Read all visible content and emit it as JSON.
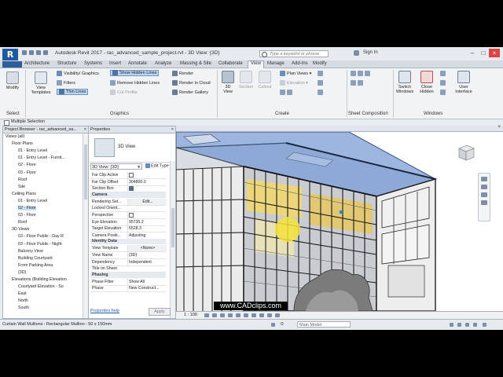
{
  "app": {
    "logo": "R",
    "title": "Autodesk Revit 2017 -    rac_advanced_sample_project.rvt - 3D View: {3D}",
    "search_placeholder": "Type a keyword or phrase",
    "sign_in": "Sign In"
  },
  "tabs": [
    "Architecture",
    "Structure",
    "Systems",
    "Insert",
    "Annotate",
    "Analyze",
    "Massing & Site",
    "Collaborate",
    "View",
    "Manage",
    "Add-Ins",
    "Modify"
  ],
  "active_tab": "View",
  "ribbon": {
    "modify": "Modify",
    "view_templates": "View Templates",
    "visibility_graphics": "Visibility/ Graphics",
    "filters": "Filters",
    "thin_lines": "Thin Lines",
    "show_hidden_lines": "Show Hidden Lines",
    "remove_hidden_lines": "Remove Hidden Lines",
    "cut_profile": "Cut Profile",
    "render": "Render",
    "render_in_cloud": "Render in Cloud",
    "render_gallery": "Render Gallery",
    "view_3d": "3D View",
    "section": "Section",
    "callout": "Callout",
    "plan_views": "Plan Views",
    "elevation": "Elevation",
    "switch_windows": "Switch Windows",
    "close_hidden": "Close Hidden",
    "user_interface": "User Interface",
    "panels": {
      "select": "Select",
      "graphics": "Graphics",
      "create": "Create",
      "sheet_composition": "Sheet Composition",
      "windows": "Windows"
    }
  },
  "multiple_selection": "Multiple Selection",
  "browser": {
    "title": "Project Browser - rac_advanced_sa...",
    "items": [
      {
        "label": "Views (all)",
        "level": 0
      },
      {
        "label": "Floor Plans",
        "level": 1
      },
      {
        "label": "01 - Entry Level",
        "level": 2
      },
      {
        "label": "01 - Entry Level - Furnit...",
        "level": 2
      },
      {
        "label": "02 - Floor",
        "level": 2
      },
      {
        "label": "03 - Floor",
        "level": 2
      },
      {
        "label": "Roof",
        "level": 2
      },
      {
        "label": "Site",
        "level": 2
      },
      {
        "label": "Ceiling Plans",
        "level": 1
      },
      {
        "label": "01 - Entry Level",
        "level": 2
      },
      {
        "label": "02 - Floor",
        "level": 2,
        "selected": true
      },
      {
        "label": "03 - Floor",
        "level": 2
      },
      {
        "label": "Roof",
        "level": 2
      },
      {
        "label": "3D Views",
        "level": 1
      },
      {
        "label": "03 - Floor Public - Day R",
        "level": 2
      },
      {
        "label": "03 - Floor Public - Night",
        "level": 2
      },
      {
        "label": "Balcony View",
        "level": 2
      },
      {
        "label": "Building Courtyard",
        "level": 2
      },
      {
        "label": "From Parking Area",
        "level": 2
      },
      {
        "label": "{3D}",
        "level": 2
      },
      {
        "label": "Elevations (Building Elevation",
        "level": 1
      },
      {
        "label": "Courtyard Elevation - So",
        "level": 2
      },
      {
        "label": "East",
        "level": 2
      },
      {
        "label": "North",
        "level": 2
      },
      {
        "label": "South",
        "level": 2
      }
    ]
  },
  "properties": {
    "title": "Properties",
    "type_name": "3D View",
    "type_selector": "3D View: {3D}",
    "edit_type": "Edit Type",
    "rows": [
      {
        "k": "Far Clip Active",
        "v": "",
        "check": false
      },
      {
        "k": "Far Clip Offset",
        "v": "304800.0"
      },
      {
        "k": "Section Box",
        "v": "",
        "check": true
      },
      {
        "head": "Camera"
      },
      {
        "k": "Rendering Set...",
        "v": "Edit...",
        "btn": true
      },
      {
        "k": "Locked Orient...",
        "v": ""
      },
      {
        "k": "Perspective",
        "v": "",
        "check": false
      },
      {
        "k": "Eye Elevation",
        "v": "95735.2"
      },
      {
        "k": "Target Elevation",
        "v": "5528.3"
      },
      {
        "k": "Camera Positi...",
        "v": "Adjusting"
      },
      {
        "head": "Identity Data"
      },
      {
        "k": "View Template",
        "v": "<None>",
        "btn": true
      },
      {
        "k": "View Name",
        "v": "{3D}"
      },
      {
        "k": "Dependency",
        "v": "Independent"
      },
      {
        "k": "Title on Sheet",
        "v": ""
      },
      {
        "head": "Phasing"
      },
      {
        "k": "Phase Filter",
        "v": "Show All"
      },
      {
        "k": "Phase",
        "v": "New Construct..."
      }
    ],
    "help": "Properties help",
    "apply": "Apply"
  },
  "viewbar": {
    "scale": "1 : 100"
  },
  "watermark": "www.CADclips.com",
  "status": {
    "text": "Curtain Wall Mullions : Rectangular Mullion : 50 x 150mm",
    "model": "Main Model",
    "zero": ":0"
  }
}
